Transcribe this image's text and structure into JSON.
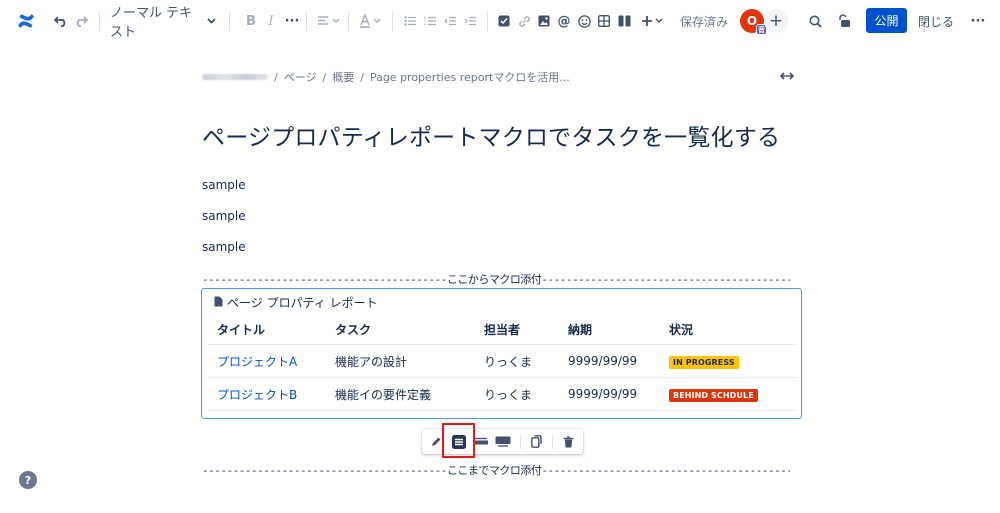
{
  "toolbar": {
    "text_style": "ノーマル テキスト",
    "saved_label": "保存済み",
    "avatar_initial": "O",
    "avatar_badge": "音",
    "publish_label": "公開",
    "close_label": "閉じる"
  },
  "breadcrumb": {
    "items": [
      "ページ",
      "概要",
      "Page properties reportマクロを活用..."
    ],
    "separator": "/"
  },
  "page": {
    "title": "ページプロパティレポートマクロでタスクを一覧化する",
    "paragraphs": [
      "sample",
      "sample",
      "sample"
    ],
    "divider_top": "ここからマクロ添付",
    "divider_bottom": "ここまでマクロ添付"
  },
  "macro": {
    "name": "ページ プロパティ レポート",
    "columns": [
      "タイトル",
      "タスク",
      "担当者",
      "納期",
      "状況"
    ],
    "rows": [
      {
        "title": "プロジェクトA",
        "task": "機能アの設計",
        "assignee": "りっくま",
        "due": "9999/99/99",
        "status": "IN PROGRESS",
        "status_bg": "#ffc400",
        "status_fg": "#172b4d"
      },
      {
        "title": "プロジェクトB",
        "task": "機能イの要件定義",
        "assignee": "りっくま",
        "due": "9999/99/99",
        "status": "BEHIND SCHDULE",
        "status_bg": "#de350b",
        "status_fg": "#ffffff"
      }
    ]
  },
  "help": {
    "label": "?"
  },
  "colors": {
    "accent": "#0052cc",
    "highlight": "#e21b1b",
    "selection": "#4c9aff"
  }
}
